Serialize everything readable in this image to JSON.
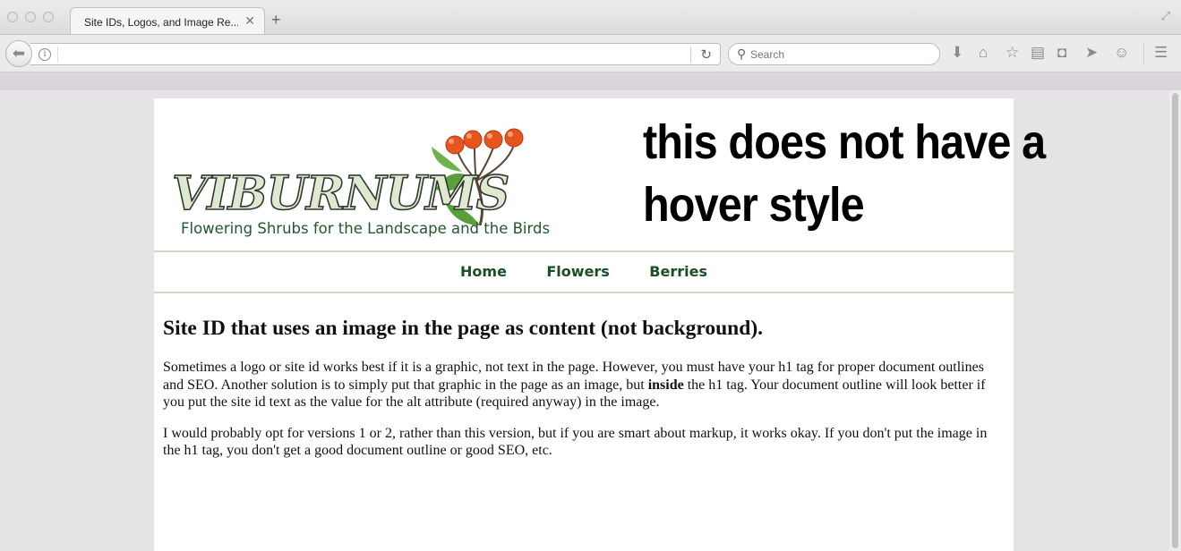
{
  "browser": {
    "tab_title": "Site IDs, Logos, and Image Re...",
    "tab_close": "✕",
    "new_tab": "+",
    "url_value": "",
    "search_placeholder": "Search",
    "toolbar_icons": [
      "back-arrow-icon",
      "info-icon",
      "reload-icon",
      "search-icon",
      "download-icon",
      "home-icon",
      "bookmark-star-icon",
      "reading-list-icon",
      "pocket-icon",
      "share-icon",
      "emoji-icon",
      "menu-icon",
      "resize-icon"
    ]
  },
  "site": {
    "logo_alt": "VIBURNUMS",
    "logo_text": "VIBURNUMS",
    "tagline": "Flowering Shrubs for the Landscape and the Birds",
    "annotation_text": "this does not have a hover style",
    "berry_color": "#e8541e",
    "leaf_color": "#5aa03a",
    "nav": [
      {
        "label": "Home"
      },
      {
        "label": "Flowers"
      },
      {
        "label": "Berries"
      }
    ]
  },
  "content": {
    "heading": "Site ID that uses an image in the page as content (not background).",
    "p1_before": "Sometimes a logo or site id works best if it is a graphic, not text in the page. However, you must have your h1 tag for proper document outlines and SEO. Another solution is to simply put that graphic in the page as an image, but ",
    "p1_bold": "inside",
    "p1_after": " the h1 tag. Your document outline will look better if you put the site id text as the value for the alt attribute (required anyway) in the image.",
    "p2": "I would probably opt for versions 1 or 2, rather than this version, but if you are smart about markup, it works okay. If you don't put the image in the h1 tag, you don't get a good document outline or good SEO, etc."
  }
}
